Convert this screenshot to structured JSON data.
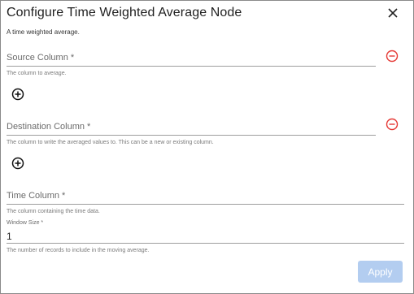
{
  "dialog": {
    "title": "Configure Time Weighted Average Node",
    "subtitle": "A time weighted average.",
    "apply_label": "Apply"
  },
  "source_column": {
    "label": "Source Column *",
    "hint": "The column to average."
  },
  "destination_column": {
    "label": "Destination Column *",
    "hint": "The column to write the averaged values to. This can be a new or existing column."
  },
  "time_column": {
    "label": "Time Column *",
    "hint": "The column containing the time data."
  },
  "window_size": {
    "label": "Window Size *",
    "value": "1",
    "hint": "The number of records to include in the moving average."
  },
  "icons": {
    "close": "close-icon",
    "remove": "remove-circle-icon",
    "add": "add-circle-icon"
  },
  "colors": {
    "remove_icon": "#e53935",
    "apply_disabled": "#b3cdf0"
  }
}
